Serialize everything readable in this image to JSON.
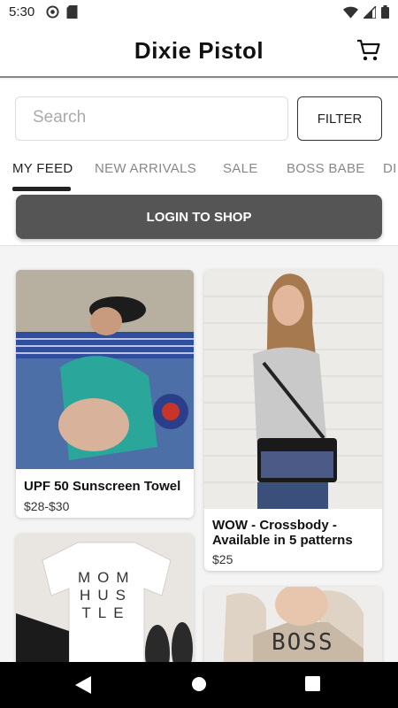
{
  "status_bar": {
    "time": "5:30"
  },
  "app": {
    "title": "Dixie Pistol"
  },
  "search": {
    "placeholder": "Search"
  },
  "filter": {
    "label": "FILTER"
  },
  "tabs": [
    {
      "label": "MY FEED"
    },
    {
      "label": "NEW ARRIVALS"
    },
    {
      "label": "SALE"
    },
    {
      "label": "BOSS BABE"
    },
    {
      "label": "DI"
    }
  ],
  "login": {
    "label": "LOGIN TO SHOP"
  },
  "products": [
    {
      "name": "UPF 50 Sunscreen Towel",
      "price": "$28-$30"
    },
    {
      "name": "WOW - Crossbody - Available in 5 patterns",
      "price": "$25"
    },
    {
      "name": "",
      "price": "",
      "image_text": [
        "MOM",
        "HUS",
        "TLE"
      ]
    },
    {
      "name": "",
      "price": "",
      "image_text": [
        "BOSS"
      ]
    }
  ],
  "colors": {
    "accent": "#555555",
    "text": "#222222",
    "nav": "#000000"
  }
}
